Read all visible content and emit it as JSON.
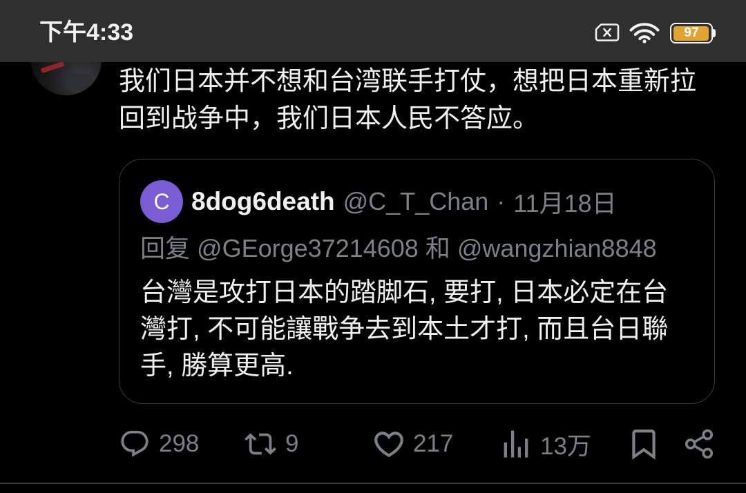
{
  "status_bar": {
    "time": "下午4:33",
    "battery_level": "97",
    "icons": [
      "sim-off-icon",
      "wifi-icon",
      "battery-icon"
    ]
  },
  "tweet": {
    "text_lines": [
      "我们日本并不想和台湾联手打仗，想把日本重新拉",
      "回到战争中，我们日本人民不答应。"
    ],
    "quote": {
      "avatar_letter": "C",
      "author_name": "8dog6death",
      "author_handle": "@C_T_Chan",
      "separator": "·",
      "date": "11月18日",
      "reply_prefix": "回复",
      "reply_to": [
        "@GEorge37214608",
        "@wangzhian8848"
      ],
      "reply_joiner": "和",
      "text_lines": [
        "台灣是攻打日本的踏脚石, 要打, 日本必定在台",
        "灣打, 不可能讓戰争去到本土才打, 而且台日聯",
        "手, 勝算更高."
      ]
    },
    "actions": [
      {
        "icon": "reply-icon",
        "count": "298"
      },
      {
        "icon": "retweet-icon",
        "count": "9"
      },
      {
        "icon": "like-icon",
        "count": "217"
      },
      {
        "icon": "views-icon",
        "count": "13万"
      },
      {
        "icon": "bookmark-icon"
      },
      {
        "icon": "share-icon"
      }
    ]
  },
  "colors": {
    "status_bar_bg": "#2f2f2f",
    "background": "#000000",
    "text_primary": "#eef0f1",
    "text_secondary": "#7c8187",
    "border": "#3a3b3d",
    "quote_avatar_bg": "#7a5cd4",
    "battery_fill": "#e2a331",
    "status_icon": "#f2f2f2"
  }
}
